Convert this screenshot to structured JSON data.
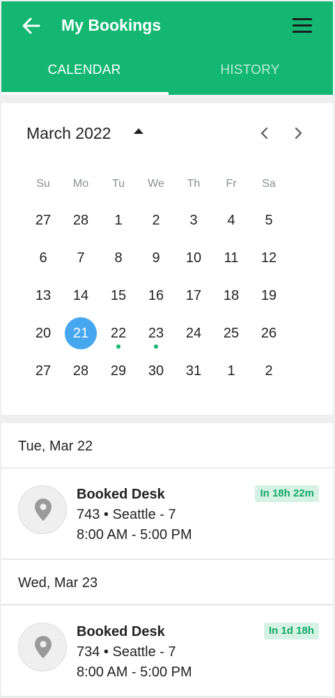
{
  "header": {
    "title": "My Bookings",
    "tabs": [
      {
        "label": "CALENDAR",
        "active": true
      },
      {
        "label": "HISTORY",
        "active": false
      }
    ],
    "accent_color": "#13b771"
  },
  "calendar": {
    "month_label": "March 2022",
    "weekdays": [
      "Su",
      "Mo",
      "Tu",
      "We",
      "Th",
      "Fr",
      "Sa"
    ],
    "weeks": [
      [
        "27",
        "28",
        "1",
        "2",
        "3",
        "4",
        "5"
      ],
      [
        "6",
        "7",
        "8",
        "9",
        "10",
        "11",
        "12"
      ],
      [
        "13",
        "14",
        "15",
        "16",
        "17",
        "18",
        "19"
      ],
      [
        "20",
        "21",
        "22",
        "23",
        "24",
        "25",
        "26"
      ],
      [
        "27",
        "28",
        "29",
        "30",
        "31",
        "1",
        "2"
      ]
    ],
    "selected_day": "21",
    "days_with_bookings": [
      "22",
      "23"
    ],
    "selected_color": "#47a7ee"
  },
  "bookings": [
    {
      "date_label": "Tue, Mar 22",
      "title": "Booked Desk",
      "location": "743 • Seattle - 7",
      "time": "8:00 AM - 5:00 PM",
      "badge": "In 18h 22m"
    },
    {
      "date_label": "Wed, Mar 23",
      "title": "Booked Desk",
      "location": "734 • Seattle - 7",
      "time": "8:00 AM - 5:00 PM",
      "badge": "In 1d 18h"
    }
  ]
}
